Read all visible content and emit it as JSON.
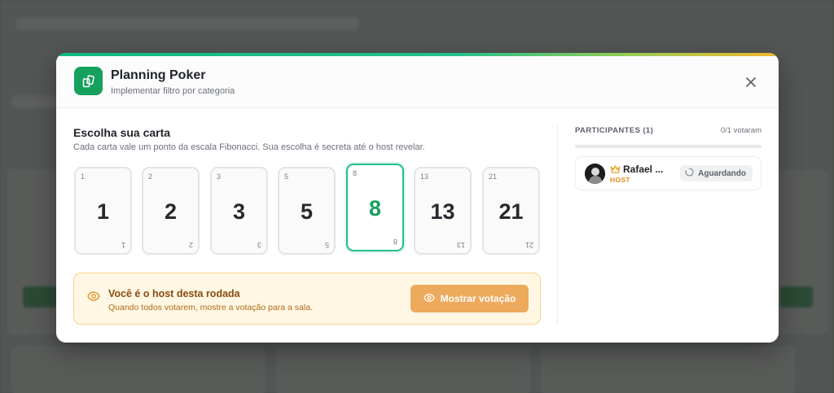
{
  "modal": {
    "title": "Planning Poker",
    "subtitle": "Implementar filtro por categoria",
    "app_icon": "cards-icon",
    "close_icon": "close-icon"
  },
  "cards_section": {
    "title": "Escolha sua carta",
    "description": "Cada carta vale um ponto da escala Fibonacci. Sua escolha é secreta até o host revelar.",
    "cards": [
      {
        "value": "1",
        "selected": false
      },
      {
        "value": "2",
        "selected": false
      },
      {
        "value": "3",
        "selected": false
      },
      {
        "value": "5",
        "selected": false
      },
      {
        "value": "8",
        "selected": true
      },
      {
        "value": "13",
        "selected": false
      },
      {
        "value": "21",
        "selected": false
      }
    ]
  },
  "host_notice": {
    "title": "Você é o host desta rodada",
    "description": "Quando todos votarem, mostre a votação para a sala.",
    "button_label": "Mostrar votação",
    "icon": "eye-icon"
  },
  "participants": {
    "title": "PARTICIPANTES (1)",
    "votes_label": "0/1 votaram",
    "progress": 0,
    "list": [
      {
        "name": "Rafael ...",
        "role": "HOST",
        "status": "Aguardando",
        "crown_icon": "crown-icon",
        "status_icon": "spinner-icon"
      }
    ]
  },
  "colors": {
    "brand_green": "#16a05d",
    "selected_border": "#22c08a",
    "host_bg": "#fff7e3",
    "host_button": "#eda95c",
    "host_role": "#e58a1f"
  }
}
